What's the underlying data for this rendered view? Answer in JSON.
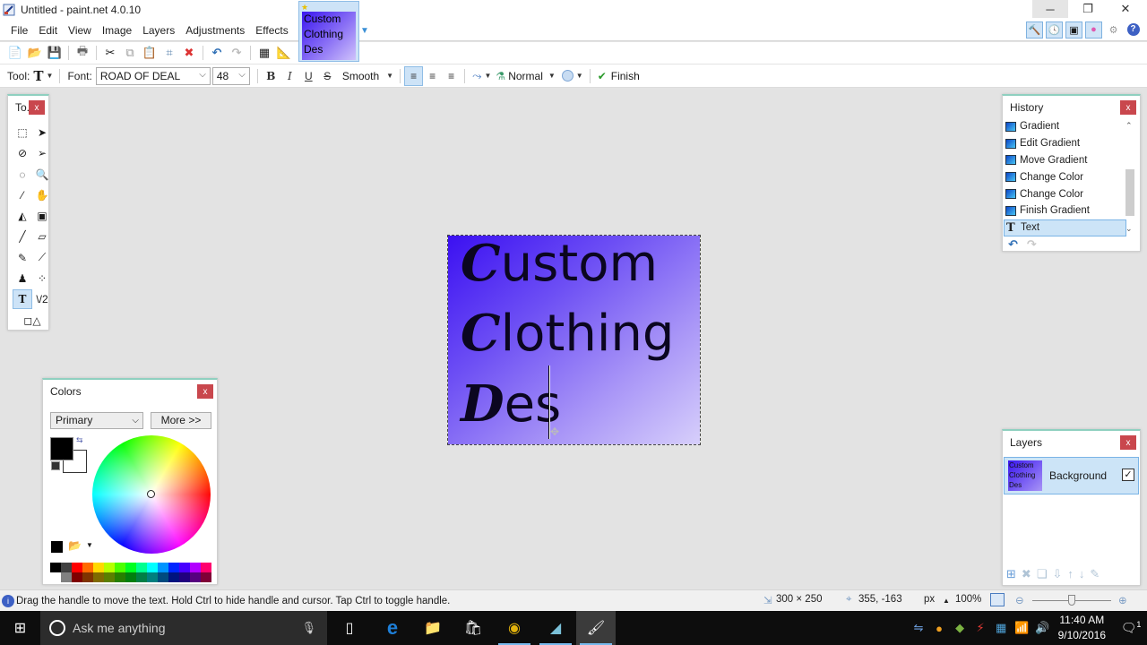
{
  "window": {
    "title": "Untitled - paint.net 4.0.10",
    "controls": {
      "minimize": "─",
      "maximize": "❐",
      "close": "✕"
    }
  },
  "menubar": {
    "items": [
      "File",
      "Edit",
      "View",
      "Image",
      "Layers",
      "Adjustments",
      "Effects"
    ]
  },
  "image_tab": {
    "lines": [
      "Custom",
      "Clothing",
      "Des"
    ],
    "star": "★"
  },
  "util_buttons": [
    {
      "name": "tools-toggle-icon",
      "glyph": "🔨"
    },
    {
      "name": "history-toggle-icon",
      "glyph": "🕓"
    },
    {
      "name": "layers-toggle-icon",
      "glyph": "▣"
    },
    {
      "name": "colors-toggle-icon",
      "glyph": "●"
    },
    {
      "name": "settings-icon",
      "glyph": "⚙"
    },
    {
      "name": "help-icon",
      "glyph": "?"
    }
  ],
  "toolbar1": {
    "buttons": [
      {
        "name": "new-image-icon",
        "glyph": "📄"
      },
      {
        "name": "open-icon",
        "glyph": "📂"
      },
      {
        "name": "save-icon",
        "glyph": "💾"
      },
      {
        "name": "print-icon",
        "glyph": "🖶"
      },
      {
        "name": "cut-icon",
        "glyph": "✂"
      },
      {
        "name": "copy-icon",
        "glyph": "⧉"
      },
      {
        "name": "paste-icon",
        "glyph": "📋"
      },
      {
        "name": "crop-to-selection-icon",
        "glyph": "⌗"
      },
      {
        "name": "deselect-icon",
        "glyph": "✖"
      },
      {
        "name": "undo-icon",
        "glyph": "↶"
      },
      {
        "name": "redo-icon",
        "glyph": "↷"
      },
      {
        "name": "grid-icon",
        "glyph": "▦"
      },
      {
        "name": "ruler-icon",
        "glyph": "📐"
      }
    ]
  },
  "toolbar2": {
    "tool_label": "Tool:",
    "tool_glyph": "T",
    "font_label": "Font:",
    "font_value": "ROAD OF DEAL",
    "size_value": "48",
    "bold": "B",
    "italic": "I",
    "underline": "U",
    "strike": "S",
    "antialias": "Smooth",
    "align_left": "≡",
    "align_center": "≡",
    "align_right": "≡",
    "blend_mode": "Normal",
    "finish": "Finish",
    "finish_glyph": "✔"
  },
  "tools_panel": {
    "title": "To...",
    "close": "x",
    "tools": [
      {
        "name": "rectangle-select-tool",
        "glyph": "⬚"
      },
      {
        "name": "move-selected-pixels-tool",
        "glyph": "➤"
      },
      {
        "name": "lasso-select-tool",
        "glyph": "⊘"
      },
      {
        "name": "move-selection-tool",
        "glyph": "➢"
      },
      {
        "name": "ellipse-select-tool",
        "glyph": "◌"
      },
      {
        "name": "zoom-tool",
        "glyph": "🔍"
      },
      {
        "name": "magic-wand-tool",
        "glyph": "⁄"
      },
      {
        "name": "pan-tool",
        "glyph": "✋"
      },
      {
        "name": "paint-bucket-tool",
        "glyph": "◭"
      },
      {
        "name": "gradient-tool",
        "glyph": "▣"
      },
      {
        "name": "paintbrush-tool",
        "glyph": "╱"
      },
      {
        "name": "eraser-tool",
        "glyph": "▱"
      },
      {
        "name": "pencil-tool",
        "glyph": "✎"
      },
      {
        "name": "color-picker-tool",
        "glyph": "⟋"
      },
      {
        "name": "clone-stamp-tool",
        "glyph": "♟"
      },
      {
        "name": "recolor-tool",
        "glyph": "⁘"
      },
      {
        "name": "text-tool",
        "glyph": "T",
        "active": true
      },
      {
        "name": "line-curve-tool",
        "glyph": "\\/2"
      },
      {
        "name": "shapes-tool",
        "glyph": "◻△"
      }
    ]
  },
  "history_panel": {
    "title": "History",
    "close": "x",
    "items": [
      {
        "label": "Gradient",
        "type": "gradient"
      },
      {
        "label": "Edit Gradient",
        "type": "gradient"
      },
      {
        "label": "Move Gradient",
        "type": "gradient"
      },
      {
        "label": "Change Color",
        "type": "gradient"
      },
      {
        "label": "Change Color",
        "type": "gradient"
      },
      {
        "label": "Finish Gradient",
        "type": "gradient"
      },
      {
        "label": "Text",
        "type": "text",
        "selected": true
      }
    ],
    "undo": "↶",
    "redo": "↷"
  },
  "layers_panel": {
    "title": "Layers",
    "close": "x",
    "layers": [
      {
        "name": "Background",
        "visible": true,
        "thumb_lines": [
          "Custom",
          "Clothing",
          "Des"
        ]
      }
    ],
    "buttons": [
      {
        "name": "add-layer-icon",
        "glyph": "⊞"
      },
      {
        "name": "delete-layer-icon",
        "glyph": "✖"
      },
      {
        "name": "duplicate-layer-icon",
        "glyph": "❏"
      },
      {
        "name": "merge-layer-down-icon",
        "glyph": "⇩"
      },
      {
        "name": "move-layer-up-icon",
        "glyph": "↑"
      },
      {
        "name": "move-layer-down-icon",
        "glyph": "↓"
      },
      {
        "name": "layer-properties-icon",
        "glyph": "✎"
      }
    ]
  },
  "colors_panel": {
    "title": "Colors",
    "close": "x",
    "mode": "Primary",
    "more_button": "More >>",
    "primary_color": "#000000",
    "secondary_color": "#ffffff",
    "palette_top": [
      "#000000",
      "#404040",
      "#ff0000",
      "#ff6a00",
      "#ffd800",
      "#b6ff00",
      "#4cff00",
      "#00ff21",
      "#00ff90",
      "#00ffff",
      "#0094ff",
      "#0026ff",
      "#4800ff",
      "#b200ff",
      "#ff006e"
    ],
    "palette_bottom": [
      "#ffffff",
      "#808080",
      "#7f0000",
      "#7f3300",
      "#7f6a00",
      "#5b7f00",
      "#267f00",
      "#007f0e",
      "#007f46",
      "#007f7f",
      "#004a7f",
      "#00137f",
      "#21007f",
      "#57007f",
      "#7f0037"
    ]
  },
  "canvas": {
    "lines": [
      {
        "cap": "C",
        "rest": "ustom"
      },
      {
        "cap": "C",
        "rest": "lothing"
      },
      {
        "cap": "D",
        "rest": "es"
      }
    ],
    "gradient_start": "#3b10f2",
    "gradient_end": "#d7cffb"
  },
  "statusbar": {
    "hint": "Drag the handle to move the text. Hold Ctrl to hide handle and cursor. Tap Ctrl to toggle handle.",
    "image_size": "300 × 250",
    "cursor_pos": "355, -163",
    "units": "px",
    "zoom": "100%",
    "zoom_slider_fraction": 0.5
  },
  "taskbar": {
    "search_placeholder": "Ask me anything",
    "apps": [
      {
        "name": "task-view-icon",
        "glyph": "▯"
      },
      {
        "name": "edge-icon",
        "glyph": "e"
      },
      {
        "name": "file-explorer-icon",
        "glyph": "📁"
      },
      {
        "name": "store-icon",
        "glyph": "🛍"
      },
      {
        "name": "chrome-icon",
        "glyph": "◉"
      },
      {
        "name": "app-icon",
        "glyph": "◢"
      },
      {
        "name": "paintnet-taskbar-icon",
        "glyph": "🖌"
      }
    ],
    "tray": [
      {
        "name": "tray-app-icon",
        "glyph": "⇋"
      },
      {
        "name": "tray-orange-icon",
        "glyph": "●"
      },
      {
        "name": "tray-bluestacks-icon",
        "glyph": "◆"
      },
      {
        "name": "tray-antivirus-icon",
        "glyph": "⚡"
      },
      {
        "name": "tray-keyboard-icon",
        "glyph": "▦"
      },
      {
        "name": "wifi-icon",
        "glyph": "📶"
      },
      {
        "name": "volume-icon",
        "glyph": "🔊"
      }
    ],
    "time": "11:40 AM",
    "date": "9/10/2016",
    "notifications": "1"
  }
}
